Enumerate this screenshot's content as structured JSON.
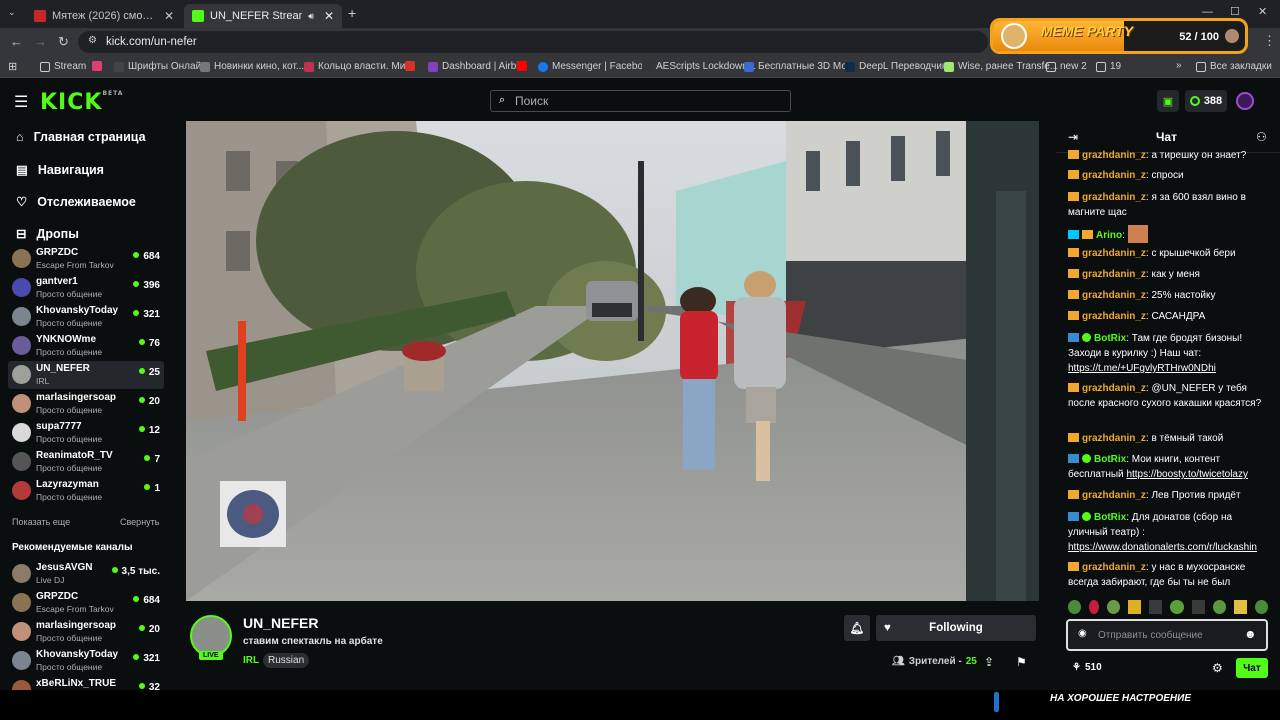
{
  "tabs": [
    {
      "title": "Мятеж (2026) смотреть онлайн",
      "active": false,
      "favicon": "#c62828"
    },
    {
      "title": "UN_NEFER Stream - Watch",
      "active": true,
      "favicon": "#53fc18"
    }
  ],
  "address": {
    "url": "kick.com/un-nefer"
  },
  "bookmarks": [
    {
      "label": "Stream",
      "icon": "folder-icon"
    },
    {
      "label": "",
      "icon": "app-icon"
    },
    {
      "label": "Шрифты Онлайн",
      "icon": "font-icon"
    },
    {
      "label": "Новинки кино, кот...",
      "icon": "film-icon"
    },
    {
      "label": "Кольцо власти. Ми...",
      "icon": "ring-icon"
    },
    {
      "label": "",
      "icon": "gmail-icon"
    },
    {
      "label": "Dashboard | Airbit",
      "icon": "airbit-icon"
    },
    {
      "label": "",
      "icon": "youtube-icon"
    },
    {
      "label": "Messenger | Facebo...",
      "icon": "facebook-icon"
    },
    {
      "label": "AEScripts Lockdown...",
      "icon": "ae-icon"
    },
    {
      "label": "Бесплатные 3D Мо...",
      "icon": "3d-icon"
    },
    {
      "label": "DeepL Переводчик",
      "icon": "deepl-icon"
    },
    {
      "label": "Wise, ранее Transfe...",
      "icon": "wise-icon"
    },
    {
      "label": "new 2",
      "icon": "folder-icon"
    },
    {
      "label": "19",
      "icon": "folder-icon"
    },
    {
      "label": "Все закладки",
      "icon": "folder-icon"
    }
  ],
  "meme": {
    "title": "MEME PARTY",
    "count": "52 / 100",
    "progress": 0.52
  },
  "header": {
    "logo": "KICK",
    "beta": "BETA",
    "search_placeholder": "Поиск",
    "coins": "388"
  },
  "sidebar": {
    "nav": [
      {
        "label": "Главная страница",
        "icon": "home-icon"
      },
      {
        "label": "Навигация",
        "icon": "browse-icon"
      },
      {
        "label": "Отслеживаемое",
        "icon": "heart-icon"
      },
      {
        "label": "Дропы",
        "icon": "gift-icon"
      }
    ],
    "following": [
      {
        "name": "GRPZDC",
        "cat": "Escape From Tarkov",
        "viewers": "684",
        "color": "#8a7355"
      },
      {
        "name": "gantver1",
        "cat": "Просто общение",
        "viewers": "396",
        "color": "#4a4ab0"
      },
      {
        "name": "KhovanskyToday",
        "cat": "Просто общение",
        "viewers": "321",
        "color": "#7a8590"
      },
      {
        "name": "YNKNOWme",
        "cat": "Просто общение",
        "viewers": "76",
        "color": "#6a5c9a"
      },
      {
        "name": "UN_NEFER",
        "cat": "IRL",
        "viewers": "25",
        "color": "#9aa29a"
      },
      {
        "name": "marlasingersoap",
        "cat": "Просто общение",
        "viewers": "20",
        "color": "#c0907a"
      },
      {
        "name": "supa7777",
        "cat": "Просто общение",
        "viewers": "12",
        "color": "#d9d9d9"
      },
      {
        "name": "ReanimatoR_TV",
        "cat": "Просто общение",
        "viewers": "7",
        "color": "#555555"
      },
      {
        "name": "Lazyrazyman",
        "cat": "Просто общение",
        "viewers": "1",
        "color": "#b33a3a"
      }
    ],
    "show_more": "Показать еще",
    "collapse": "Свернуть",
    "recommended_title": "Рекомендуемые каналы",
    "recommended": [
      {
        "name": "JesusAVGN",
        "cat": "Live DJ",
        "viewers": "3,5 тыс.",
        "color": "#8a7a6a"
      },
      {
        "name": "GRPZDC",
        "cat": "Escape From Tarkov",
        "viewers": "684",
        "color": "#8a7355"
      },
      {
        "name": "marlasingersoap",
        "cat": "Просто общение",
        "viewers": "20",
        "color": "#c0907a"
      },
      {
        "name": "KhovanskyToday",
        "cat": "Просто общение",
        "viewers": "321",
        "color": "#7a8590"
      },
      {
        "name": "xBeRLiNx_TRUE",
        "cat": "",
        "viewers": "32",
        "color": "#9a5a3a"
      }
    ]
  },
  "stream": {
    "channel": "UN_NEFER",
    "title": "ставим спектакль на арбате",
    "live": "LIVE",
    "category": "IRL",
    "tag": "Russian",
    "following_label": "Following",
    "viewers_label": "Зрителей -",
    "viewers": "25"
  },
  "chat": {
    "title": "Чат",
    "messages": [
      {
        "user": "grazhdanin_z",
        "text": "а тирешку он знает?",
        "color": "#f0a830",
        "badges": [
          "crown"
        ]
      },
      {
        "user": "grazhdanin_z",
        "text": "спроси",
        "color": "#f0a830",
        "badges": [
          "crown"
        ]
      },
      {
        "user": "grazhdanin_z",
        "text": "я за 600 взял вино в магните щас",
        "color": "#f0a830",
        "badges": [
          "crown"
        ]
      },
      {
        "user": "Arino",
        "text": "",
        "color": "#53fc18",
        "badges": [
          "mod",
          "crown"
        ]
      },
      {
        "user": "grazhdanin_z",
        "text": "с крышечкой бери",
        "color": "#f0a830",
        "badges": [
          "crown"
        ]
      },
      {
        "user": "grazhdanin_z",
        "text": "как у меня",
        "color": "#f0a830",
        "badges": [
          "crown"
        ]
      },
      {
        "user": "grazhdanin_z",
        "text": "25% настойку",
        "color": "#f0a830",
        "badges": [
          "crown"
        ]
      },
      {
        "user": "grazhdanin_z",
        "text": "САСАНДРА",
        "color": "#f0a830",
        "badges": [
          "crown"
        ]
      },
      {
        "user": "BotRix",
        "text": "Там где бродят бизоны! Заходи в курилку :) Наш чат:",
        "link": "https://t.me/+UFgvlyRTHrw0NDhi",
        "color": "#53fc18",
        "badges": [
          "bot",
          "verified"
        ]
      },
      {
        "user": "grazhdanin_z",
        "text": "@UN_NEFER у тебя после красного сухого какашки красятся?",
        "color": "#f0a830",
        "badges": [
          "crown"
        ]
      },
      {
        "user": "grazhdanin_z",
        "text": "в тёмный такой",
        "color": "#f0a830",
        "badges": [
          "crown"
        ]
      },
      {
        "user": "BotRix",
        "text": "Мои книги, контент бесплатный",
        "link": "https://boosty.to/twicetolazy",
        "color": "#53fc18",
        "badges": [
          "bot",
          "verified"
        ]
      },
      {
        "user": "grazhdanin_z",
        "text": "Лев Против придёт",
        "color": "#f0a830",
        "badges": [
          "crown"
        ]
      },
      {
        "user": "BotRix",
        "text": "Для донатов (сбор на уличный театр) :",
        "link": "https://www.donationalerts.com/r/luckashin",
        "color": "#53fc18",
        "badges": [
          "bot",
          "verified"
        ]
      },
      {
        "user": "grazhdanin_z",
        "text": "у нас в мухосранске всегда забирают, где бы ты не был",
        "color": "#f0a830",
        "badges": [
          "crown"
        ]
      }
    ],
    "input_placeholder": "Отправить сообщение",
    "points": "510",
    "send_label": "Чат"
  },
  "overlay": {
    "bottom_text": "НА ХОРОШЕЕ НАСТРОЕНИЕ"
  },
  "colors": {
    "accent": "#53fc18",
    "bg": "#0b0e0f",
    "panel": "#24272c"
  }
}
